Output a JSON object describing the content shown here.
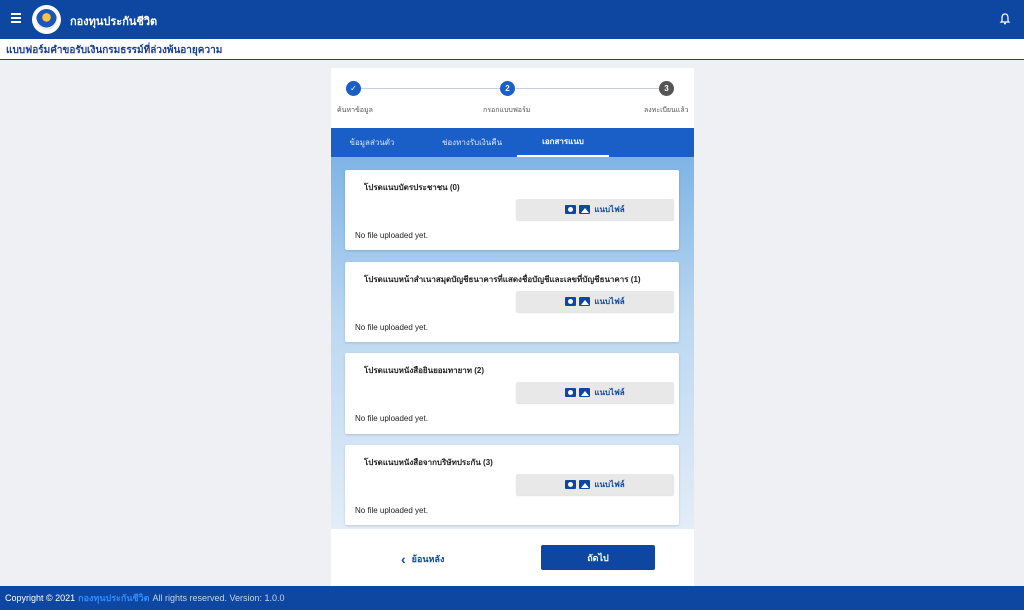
{
  "header": {
    "app_title": "กองทุนประกันชีวิต",
    "menu_icon": "menu-icon",
    "logo_icon": "logo-icon",
    "bell_icon": "bell-icon"
  },
  "subheader": {
    "title": "แบบฟอร์มคำขอรับเงินกรมธรรม์ที่ล่วงพ้นอายุความ"
  },
  "stepper": {
    "steps": [
      {
        "number": "✓",
        "label": "ค้นหาข้อมูล",
        "state": "done"
      },
      {
        "number": "2",
        "label": "กรอกแบบฟอร์ม",
        "state": "active"
      },
      {
        "number": "3",
        "label": "ลงทะเบียนแล้ว",
        "state": "pending"
      }
    ]
  },
  "tabs": [
    {
      "label": "ข้อมูลส่วนตัว",
      "active": false
    },
    {
      "label": "ช่องทางรับเงินคืน",
      "active": false
    },
    {
      "label": "เอกสารแนบ",
      "active": true
    }
  ],
  "uploads": [
    {
      "title": "โปรดแนบบัตรประชาชน (0)",
      "button_label": "แนบไฟล์",
      "status": "No file uploaded yet."
    },
    {
      "title": "โปรดแนบหน้าสำเนาสมุดบัญชีธนาคารที่แสดงชื่อบัญชีและเลขที่บัญชีธนาคาร (1)",
      "button_label": "แนบไฟล์",
      "status": "No file uploaded yet."
    },
    {
      "title": "โปรดแนบหนังสือยินยอมทายาท (2)",
      "button_label": "แนบไฟล์",
      "status": "No file uploaded yet."
    },
    {
      "title": "โปรดแนบหนังสือจากบริษัทประกัน (3)",
      "button_label": "แนบไฟล์",
      "status": "No file uploaded yet."
    }
  ],
  "actions": {
    "back_label": "ย้อนหลัง",
    "next_label": "ถัดไป"
  },
  "footer": {
    "copyright": "Copyright © 2021",
    "brand": "กองทุนประกันชีวิต",
    "rights": "All rights reserved. Version: 1.0.0"
  },
  "colors": {
    "primary": "#0e47a1",
    "tab_bar": "#1a5fc7",
    "step_done": "#1a5fc7",
    "step_pending": "#555555"
  }
}
